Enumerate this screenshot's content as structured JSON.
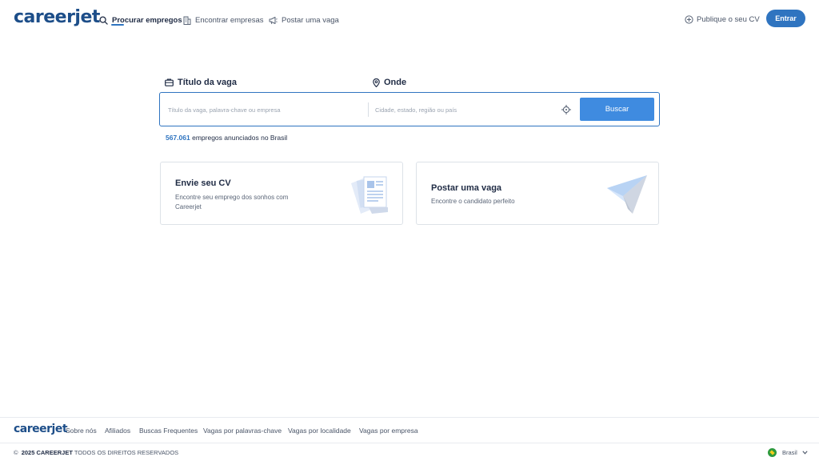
{
  "header": {
    "logo": "careerjet",
    "nav": [
      {
        "label": "Procurar empregos",
        "icon": "search-icon",
        "active": true
      },
      {
        "label": "Encontrar empresas",
        "icon": "building-icon"
      },
      {
        "label": "Postar uma vaga",
        "icon": "megaphone-icon"
      }
    ],
    "publish_cv": "Publique o seu CV",
    "login": "Entrar"
  },
  "search": {
    "job_label": "Título da vaga",
    "job_placeholder": "Título da vaga, palavra-chave ou empresa",
    "job_value": "",
    "where_label": "Onde",
    "where_placeholder": "Cidade, estado, região ou país",
    "where_value": "",
    "button": "Buscar",
    "stats_count": "567.061",
    "stats_text": "empregos anunciados no Brasil"
  },
  "cards": [
    {
      "title": "Envie seu CV",
      "desc_line1": "Encontre seu emprego dos sonhos com",
      "desc_line2": "Careerjet",
      "icon": "cv-documents-icon"
    },
    {
      "title": "Postar uma vaga",
      "desc": "Encontre o candidato perfeito",
      "icon": "paper-plane-icon"
    }
  ],
  "footer": {
    "logo": "careerjet",
    "links": [
      "Sobre nós",
      "Afiliados",
      "Buscas Frequentes",
      "Vagas por palavras-chave",
      "Vagas por localidade",
      "Vagas por empresa"
    ],
    "copyright_symbol": "©",
    "copyright_brand": "2025 CAREERJET",
    "copyright_rest": "TODOS OS DIREITOS RESERVADOS",
    "country": "Brasil"
  },
  "colors": {
    "brand": "#1d4e89",
    "accent": "#2f74c0",
    "button": "#3f8be0"
  }
}
